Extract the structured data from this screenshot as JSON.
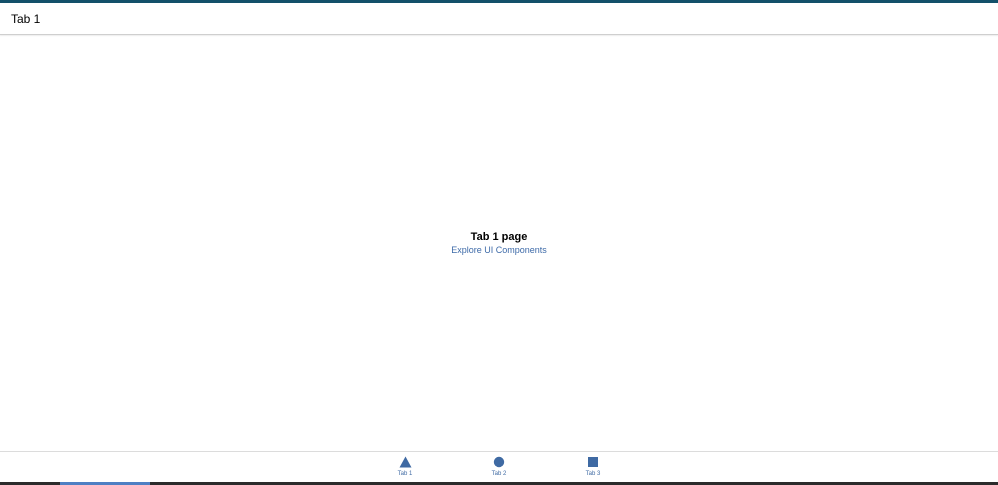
{
  "header": {
    "title": "Tab 1"
  },
  "main": {
    "title": "Tab 1 page",
    "link": "Explore UI Components"
  },
  "tabbar": {
    "tabs": [
      {
        "label": "Tab 1",
        "icon": "triangle-icon"
      },
      {
        "label": "Tab 2",
        "icon": "ellipse-icon"
      },
      {
        "label": "Tab 3",
        "icon": "square-icon"
      }
    ]
  },
  "colors": {
    "accent": "#13506a",
    "link": "#3d6aa8",
    "tab_icon": "#3f6aa3"
  }
}
